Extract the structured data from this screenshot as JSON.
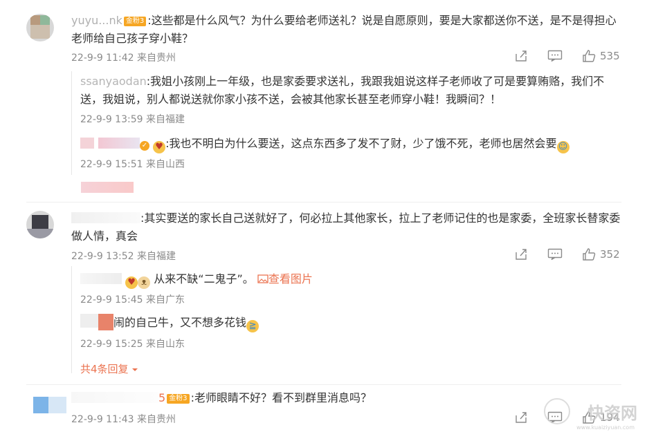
{
  "comments": [
    {
      "name": "yuyu...nk",
      "badge": "金粉3",
      "text": ":这些都是什么风气？为什么要给老师送礼？说是自愿原则，要是大家都送你不送，是不是得担心老师给自己孩子穿小鞋？",
      "meta": "22-9-9 11:42 来自贵州",
      "likes": "535",
      "replies": [
        {
          "name": "ssanyaodan",
          "text": ":我姐小孩刚上一年级，也是家委要求送礼，我跟我姐说这样子老师收了可是要算贿赂，我们不送，我姐说，别人都说送就你家小孩不送，会被其他家长甚至老师穿小鞋！我瞬间？！",
          "meta": "22-9-9 13:59 来自福建"
        },
        {
          "name": "",
          "text": ":我也不明白为什么要送，这点东西多了发不了财，少了饿不死，老师也居然会要",
          "meta": "22-9-9 15:51 来自山西"
        }
      ]
    },
    {
      "name": "",
      "text": ":其实要送的家长自己送就好了，何必拉上其他家长，拉上了老师记住的也是家委，全班家长替家委做人情，真会",
      "meta": "22-9-9 13:52 来自福建",
      "likes": "352",
      "replies": [
        {
          "name": "",
          "text": "从来不缺“二鬼子”。",
          "link": "查看图片",
          "meta": "22-9-9 15:45 来自广东"
        },
        {
          "name": "",
          "text": "闹的自己牛，又不想多花钱",
          "meta": "22-9-9 15:25 来自山东"
        }
      ],
      "more": "共4条回复"
    },
    {
      "name": "5",
      "badge": "金粉3",
      "text": ":老师眼睛不好？看不到群里消息吗？",
      "meta": "22-9-9 11:43 来自贵州",
      "likes": "194"
    }
  ],
  "watermark": {
    "title": "快资网",
    "sub": "www.kuaiziyuan.com"
  },
  "colors": {
    "name": "#eb7350",
    "meta": "#8a8a8a",
    "badge": "#f6a623"
  },
  "icons": [
    "share-icon",
    "comment-icon",
    "like-icon",
    "image-icon",
    "chevron-down-icon",
    "verified-icon"
  ]
}
